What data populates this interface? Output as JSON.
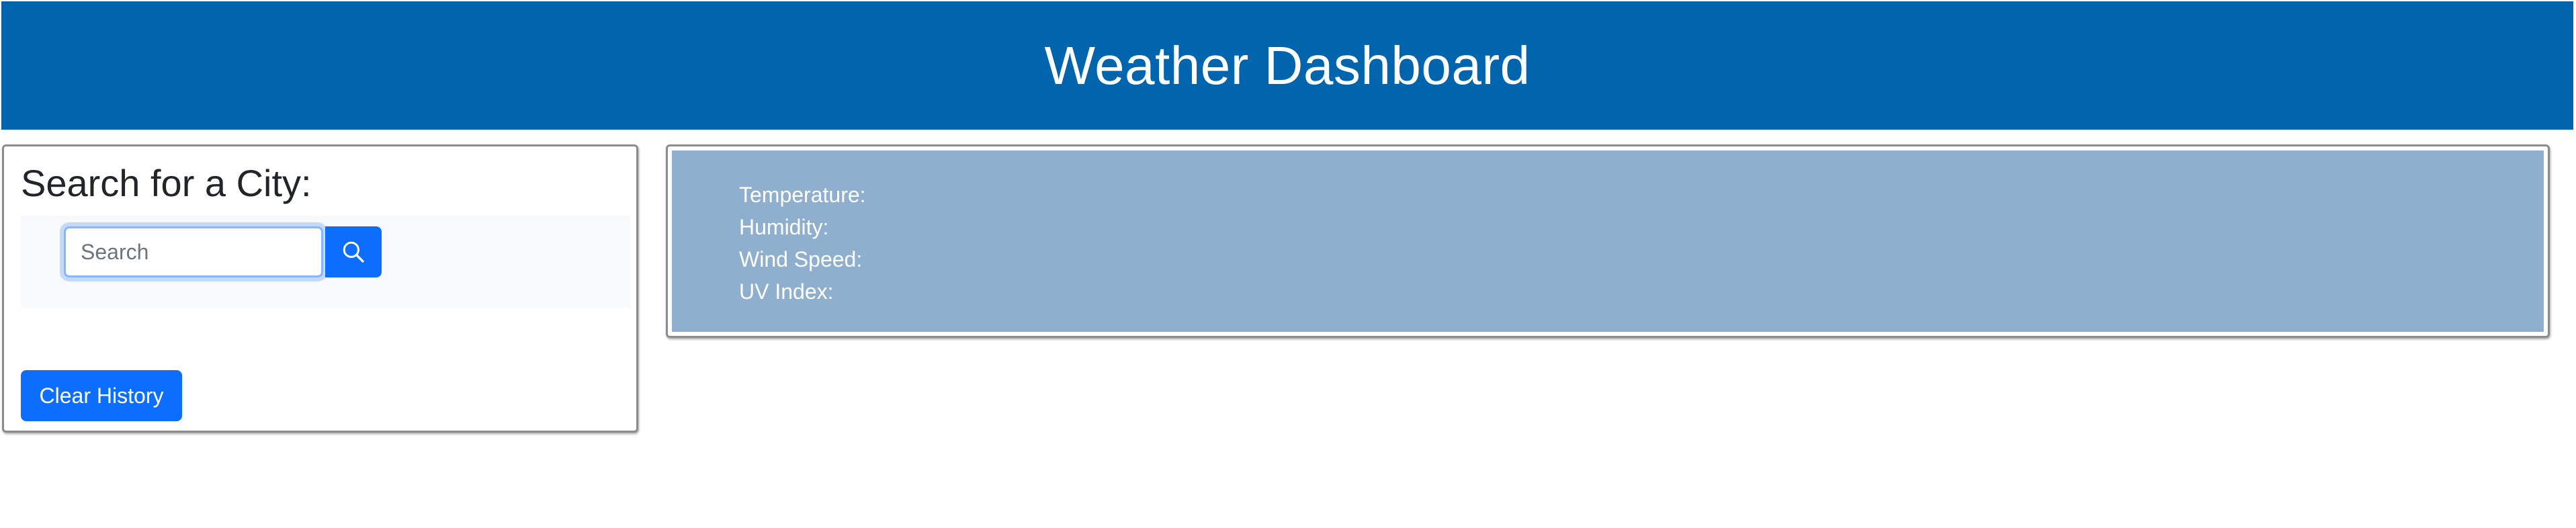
{
  "header": {
    "title": "Weather Dashboard",
    "background": "#0065ac"
  },
  "search_panel": {
    "title": "Search for a City:",
    "input": {
      "placeholder": "Search",
      "value": ""
    },
    "search_icon": "search-icon",
    "clear_label": "Clear History",
    "accent": "#0d6efd"
  },
  "weather_panel": {
    "background": "#8eafcd",
    "labels": {
      "temperature": "Temperature:",
      "humidity": "Humidity:",
      "wind_speed": "Wind Speed:",
      "uv_index": "UV Index:"
    }
  }
}
